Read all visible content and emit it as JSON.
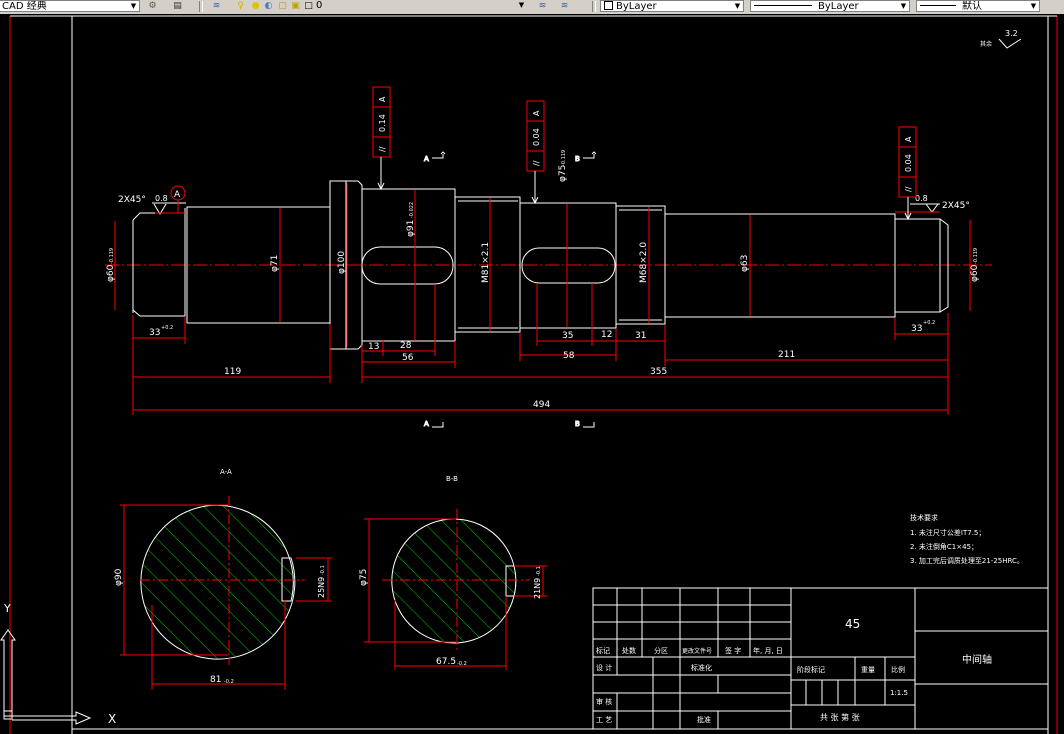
{
  "toolbar": {
    "workspace": "CAD 经典",
    "layer_value": "0",
    "color": "ByLayer",
    "linetype": "ByLayer",
    "lineweight": "默认"
  },
  "drawing": {
    "colors": {
      "background": "#000000",
      "outline": "#ffffff",
      "dimension": "#ff0000",
      "centerline": "#ff0000",
      "hatch": "#00cc00",
      "frame": "#ffffff",
      "border": "#ff0000",
      "tolerance": "#ffffff"
    },
    "roughness_corner": {
      "symbol_value": "3.2",
      "label": "其余"
    },
    "datum_label": "A",
    "chamfer_left": "2X45°",
    "chamfer_right": "2X45°",
    "fcf": [
      {
        "symbol": "//",
        "value": "0.14",
        "datum": "A"
      },
      {
        "symbol": "//",
        "value": "0.04",
        "datum": "A"
      },
      {
        "symbol": "//",
        "value": "0.04",
        "datum": "A"
      }
    ],
    "small_marks": [
      "0.8",
      "0.8"
    ],
    "section_marks": {
      "a1": "A",
      "a2": "A",
      "b1": "B",
      "b2": "B"
    },
    "diameters": {
      "d60_left": "φ60",
      "d71": "φ71",
      "d100": "φ100",
      "d91": "φ91",
      "m81": "M81×2.1",
      "d75": "φ75",
      "m68": "M68×2.0",
      "d63": "φ63",
      "d60_right": "φ60"
    },
    "tolerances": {
      "d60": "-0.119",
      "d91": "-0.022",
      "d75": "-0.119",
      "len33": "+0.2"
    },
    "lengths": {
      "l33_left": "33",
      "l33_right": "33",
      "l13": "13",
      "l28": "28",
      "l56": "56",
      "l35": "35",
      "l12": "12",
      "l58": "58",
      "l31": "31",
      "l211": "211",
      "l119": "119",
      "l355": "355",
      "l494": "494"
    },
    "section_a": {
      "title": "A-A",
      "dia": "φ90",
      "width": "81",
      "width_tol": "-0.2",
      "key": "25N9",
      "key_tol": "-0.1"
    },
    "section_b": {
      "title": "B-B",
      "dia": "φ75",
      "width": "67.5",
      "width_tol": "-0.2",
      "key": "21N9",
      "key_tol": "-0.1"
    },
    "tech_requirements": {
      "title": "技术要求",
      "items": [
        "1. 未注尺寸公差IT7.5；",
        "2. 未注倒角C1×45；",
        "3. 加工完后调质处理至21-25HRC。"
      ]
    },
    "title_block": {
      "material": "45",
      "part_name": "中间轴",
      "headers": [
        "标记",
        "处数",
        "分区",
        "更改文件号",
        "签 字",
        "年, 月, 日"
      ],
      "row_design": "设 计",
      "row_standard": "标准化",
      "stage_mark": "阶段标记",
      "weight": "重量",
      "scale_label": "比例",
      "scale_value": "1:1.5",
      "review": "审 核",
      "process": "工 艺",
      "approve": "批准",
      "sheets": "共  张  第  张"
    },
    "ucs": {
      "y": "Y",
      "x": "X"
    }
  }
}
